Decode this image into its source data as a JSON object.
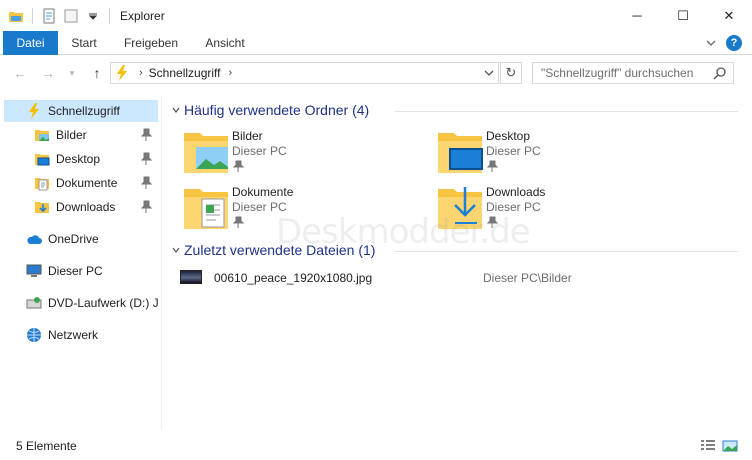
{
  "window": {
    "title": "Explorer",
    "controls": {
      "minimize": "─",
      "maximize": "☐",
      "close": "✕"
    }
  },
  "ribbon": {
    "tabs": [
      "Datei",
      "Start",
      "Freigeben",
      "Ansicht"
    ],
    "help": "?"
  },
  "nav": {
    "back": "←",
    "forward": "→",
    "up": "↑",
    "breadcrumb": "Schnellzugriff",
    "refresh": "↻",
    "search_placeholder": "\"Schnellzugriff\" durchsuchen"
  },
  "sidebar": {
    "items": [
      {
        "label": "Schnellzugriff",
        "icon": "star-lightning-icon"
      },
      {
        "label": "Bilder",
        "icon": "pictures-folder-icon"
      },
      {
        "label": "Desktop",
        "icon": "desktop-folder-icon"
      },
      {
        "label": "Dokumente",
        "icon": "documents-folder-icon"
      },
      {
        "label": "Downloads",
        "icon": "downloads-folder-icon"
      },
      {
        "label": "OneDrive",
        "icon": "cloud-icon"
      },
      {
        "label": "Dieser PC",
        "icon": "computer-icon"
      },
      {
        "label": "DVD-Laufwerk (D:) J_",
        "icon": "dvd-drive-icon"
      },
      {
        "label": "Netzwerk",
        "icon": "network-icon"
      }
    ]
  },
  "frequent": {
    "header": "Häufig verwendete Ordner (4)",
    "folders": [
      {
        "name": "Bilder",
        "location": "Dieser PC"
      },
      {
        "name": "Desktop",
        "location": "Dieser PC"
      },
      {
        "name": "Dokumente",
        "location": "Dieser PC"
      },
      {
        "name": "Downloads",
        "location": "Dieser PC"
      }
    ]
  },
  "recent": {
    "header": "Zuletzt verwendete Dateien (1)",
    "files": [
      {
        "name": "00610_peace_1920x1080.jpg",
        "path": "Dieser PC\\Bilder"
      }
    ]
  },
  "watermark": "Deskmodder.de",
  "status": {
    "count": "5 Elemente"
  },
  "colors": {
    "accent": "#1979ca",
    "selection": "#cce8ff",
    "header_text": "#1e3287",
    "folder_yellow": "#f8c542"
  }
}
